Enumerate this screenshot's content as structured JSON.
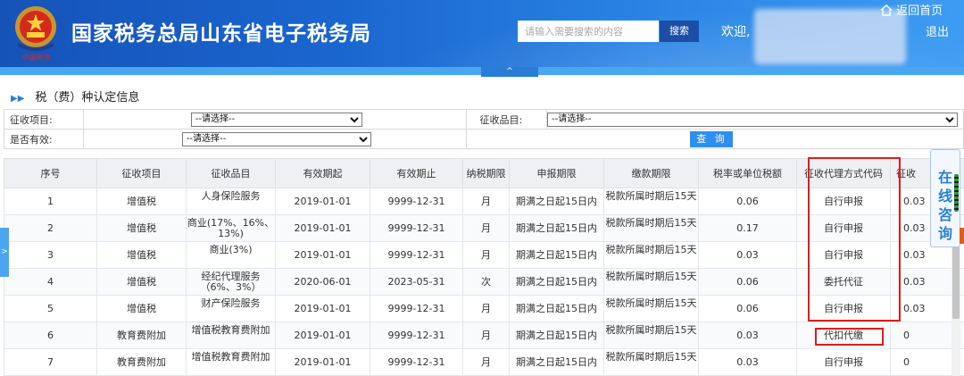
{
  "header": {
    "site_title": "国家税务总局山东省电子税务局",
    "search_placeholder": "请输入需要搜索的内容",
    "search_button": "搜索",
    "welcome": "欢迎,",
    "home_link": "返回首页",
    "logout": "退出",
    "emblem_caption": "中国税务"
  },
  "collapse_label": "^",
  "section": {
    "title": "税（费）种认定信息"
  },
  "filters": {
    "collection_item_label": "征收项目:",
    "collection_item_value": "--请选择--",
    "collection_subitem_label": "征收品目:",
    "collection_subitem_value": "--请选择--",
    "is_valid_label": "是否有效:",
    "is_valid_value": "--请选择--",
    "query_button": "查 询"
  },
  "table": {
    "columns": [
      "序号",
      "征收项目",
      "征收品目",
      "有效期起",
      "有效期止",
      "纳税期限",
      "申报期限",
      "缴款期限",
      "税率或单位税额",
      "征收代理方式代码",
      "征收"
    ],
    "rows": [
      [
        "1",
        "增值税",
        "人身保险服务",
        "2019-01-01",
        "9999-12-31",
        "月",
        "期满之日起15日内",
        "税款所属时期后15天",
        "0.06",
        "自行申报",
        "0.03"
      ],
      [
        "2",
        "增值税",
        "商业(17%、16%、13%)",
        "2019-01-01",
        "9999-12-31",
        "月",
        "期满之日起15日内",
        "税款所属时期后15天",
        "0.17",
        "自行申报",
        "0.03"
      ],
      [
        "3",
        "增值税",
        "商业(3%)",
        "2019-01-01",
        "9999-12-31",
        "月",
        "期满之日起15日内",
        "税款所属时期后15天",
        "0.03",
        "自行申报",
        "0.03"
      ],
      [
        "4",
        "增值税",
        "经纪代理服务（6%、3%）",
        "2020-06-01",
        "2023-05-31",
        "次",
        "期满之日起15日内",
        "税款所属时期后15天",
        "0.06",
        "委托代征",
        "0.03"
      ],
      [
        "5",
        "增值税",
        "财产保险服务",
        "2019-01-01",
        "9999-12-31",
        "月",
        "期满之日起15日内",
        "税款所属时期后15天",
        "0.06",
        "自行申报",
        "0.03"
      ],
      [
        "6",
        "教育费附加",
        "增值税教育费附加",
        "2019-01-01",
        "9999-12-31",
        "月",
        "期满之日起15日内",
        "税款所属时期后15天",
        "0.03",
        "代扣代缴",
        "0"
      ],
      [
        "7",
        "教育费附加",
        "增值税教育费附加",
        "2019-01-01",
        "9999-12-31",
        "月",
        "期满之日起15日内",
        "税款所属时期后15天",
        "0.03",
        "自行申报",
        "0"
      ]
    ]
  },
  "side": {
    "expand_label": ">",
    "online_consult": "在线咨询"
  },
  "colors": {
    "header_blue": "#1a66cf",
    "accent_blue": "#2e8ff0",
    "highlight_red": "#e21b1b"
  }
}
